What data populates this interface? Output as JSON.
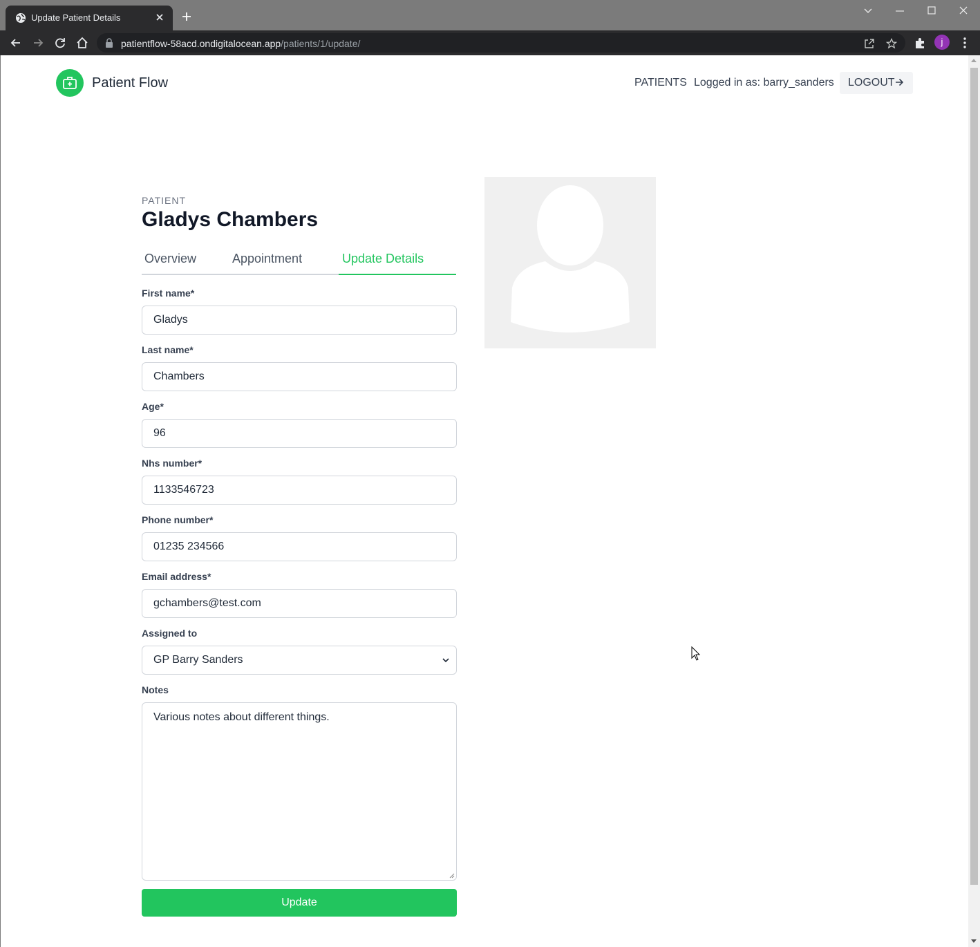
{
  "browser": {
    "tab_title": "Update Patient Details",
    "url_host": "patientflow-58acd.ondigitalocean.app",
    "url_path": "/patients/1/update/",
    "profile_initial": "j"
  },
  "header": {
    "brand": "Patient Flow",
    "nav_patients": "PATIENTS",
    "logged_in": "Logged in as: barry_sanders",
    "logout": "LOGOUT"
  },
  "patient": {
    "eyebrow": "PATIENT",
    "name": "Gladys Chambers"
  },
  "tabs": [
    {
      "label": "Overview",
      "active": false
    },
    {
      "label": "Appointment",
      "active": false
    },
    {
      "label": "Update Details",
      "active": true
    }
  ],
  "form": {
    "first_name": {
      "label": "First name*",
      "value": "Gladys"
    },
    "last_name": {
      "label": "Last name*",
      "value": "Chambers"
    },
    "age": {
      "label": "Age*",
      "value": "96"
    },
    "nhs_number": {
      "label": "Nhs number*",
      "value": "1133546723"
    },
    "phone": {
      "label": "Phone number*",
      "value": "01235 234566"
    },
    "email": {
      "label": "Email address*",
      "value": "gchambers@test.com"
    },
    "assigned_to": {
      "label": "Assigned to",
      "value": "GP Barry Sanders"
    },
    "notes": {
      "label": "Notes",
      "value": "Various notes about different things."
    },
    "submit": "Update"
  },
  "colors": {
    "accent": "#22c55e",
    "chrome_dark": "#2b2b2d",
    "titlebar": "#7b7b7b"
  },
  "icons": {
    "tab": "globe-icon",
    "logo": "medical-kit-icon",
    "logout": "arrow-right-icon",
    "select": "chevron-down-icon",
    "avatar_placeholder": "person-silhouette-icon"
  }
}
